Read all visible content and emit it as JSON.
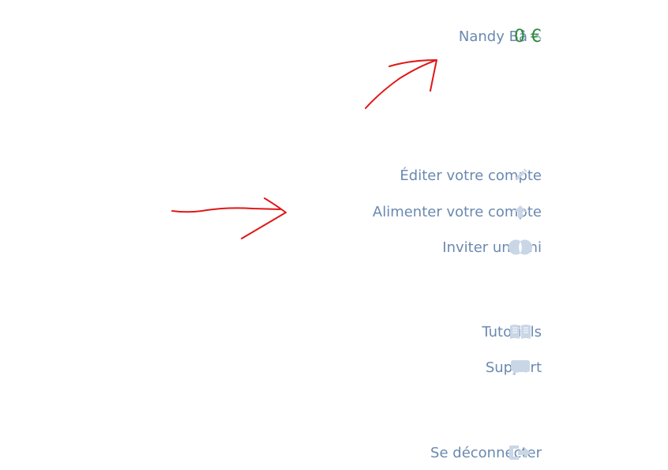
{
  "user": {
    "name": "Nandy Bâ",
    "chevron_icon": "chevron-up-icon",
    "balance": "0 €"
  },
  "menu": {
    "account": [
      {
        "label": "Éditer votre compte",
        "icon": "pencil-icon"
      },
      {
        "label": "Alimenter votre compte",
        "icon": "arrow-up-icon"
      },
      {
        "label": "Inviter un ami",
        "icon": "invite-icon"
      }
    ],
    "help": [
      {
        "label": "Tutoriels",
        "icon": "book-icon"
      },
      {
        "label": "Support",
        "icon": "chat-icon"
      }
    ],
    "logout": {
      "label": "Se déconnecter",
      "icon": "logout-icon"
    }
  },
  "colors": {
    "link": "#6a89b0",
    "icon": "#c9d6e6",
    "balance": "#2e8b3d",
    "annotation": "#e01818"
  }
}
